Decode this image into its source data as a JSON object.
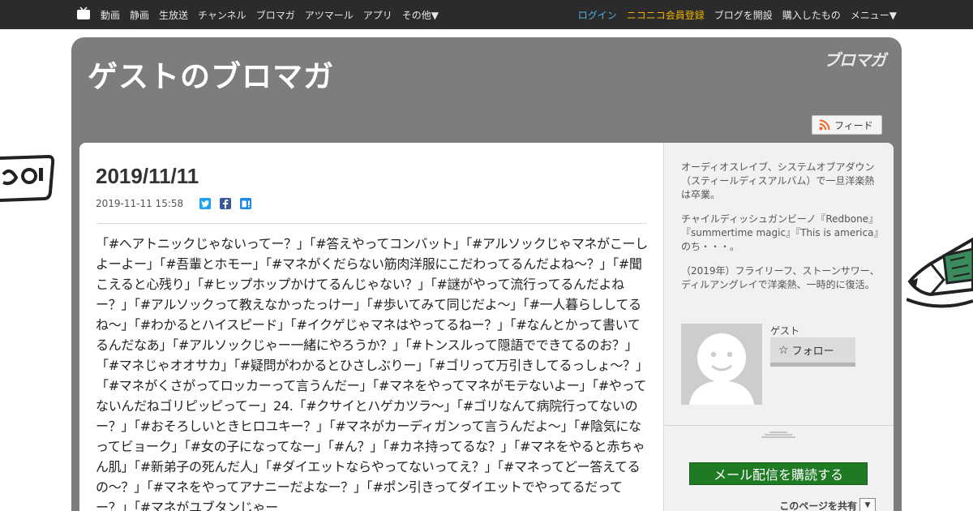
{
  "nav": {
    "left_items": [
      "動画",
      "静画",
      "生放送",
      "チャンネル",
      "ブロマガ",
      "アツマール",
      "アプリ",
      "その他▼"
    ],
    "login": "ログイン",
    "register": "ニコニコ会員登録",
    "open_blog": "ブログを開設",
    "purchased": "購入したもの",
    "menu": "メニュー▼"
  },
  "blog": {
    "title": "ゲストのブロマガ",
    "logo_text": "ブロマガ",
    "feed_label": "フィード"
  },
  "post": {
    "date_heading": "2019/11/11",
    "timestamp": "2019-11-11 15:58",
    "share_icons": [
      "twitter-icon",
      "facebook-icon",
      "hatena-icon"
    ],
    "body": "「#ヘアトニックじゃないってー？」「#答えやってコンバット」「#アルソックじゃマネがこーしよーよー」「#吾輩とホモー」「#マネがくだらない筋肉洋服にこだわってるんだよね〜？」「#聞こえると心残り」「#ヒップホップかけてるんじゃない？」「#謎がやって流行ってるんだよねー？」「#アルソックって教えなかったっけー」「#歩いてみて同じだよ〜」「#一人暮らししてるね〜」「#わかるとハイスピード」「#イクゲじゃマネはやってるねー？」「#なんとかって書いてるんだなあ」「#アルソックじゃー一緒にやろうか？」「#トンスルって隠語でできてるのお？」「#マネじゃオオサカ」「#疑問がわかるとひさしぶりー」「#ゴリって万引きしてるっしょ〜？」「#マネがくさがってロッカーって言うんだー」「#マネをやってマネがモテないよー」「#やってないんだねゴリピッピってー」24.「#クサイとハゲカツラ〜」「#ゴリなんて病院行ってないのー？」「#おそろしいときヒロユキー？」「#マネがカーディガンって言うんだよ〜」「#陰気になってビョーク」「#女の子になってなー」「#ん？」「#カネ持ってるな？」「#マネをやると赤ちゃん肌」「#新弟子の死んだ人」「#ダイエットならやってないってえ？」「#マネってどー答えてるの〜？」「#マネをやってアナニーだよなー？」「#ポン引きってダイエットでやってるだってー？」「#マネがユブタンじゃー"
  },
  "sidebar": {
    "profile": [
      "オーディオスレイブ、システムオブアダウン（スティールディスアルバム）で一旦洋楽熱は卒業。",
      "チャイルディッシュガンビーノ『Redbone』『summertime magic』『This is america』のち・・・。",
      "（2019年）フライリーフ、ストーンサワー、ディルアングレイで洋楽熱、一時的に復活。"
    ],
    "user_name": "ゲスト",
    "follow_label": "フォロー",
    "mail_button": "メール配信を購読する",
    "share_page": "このページを共有",
    "share_dropdown": "▼"
  },
  "colors": {
    "topbar": "#2b2b2b",
    "container": "#7d7d7d",
    "login": "#4fb0e0",
    "register": "#f0b400",
    "mail_button": "#1e7b24"
  }
}
